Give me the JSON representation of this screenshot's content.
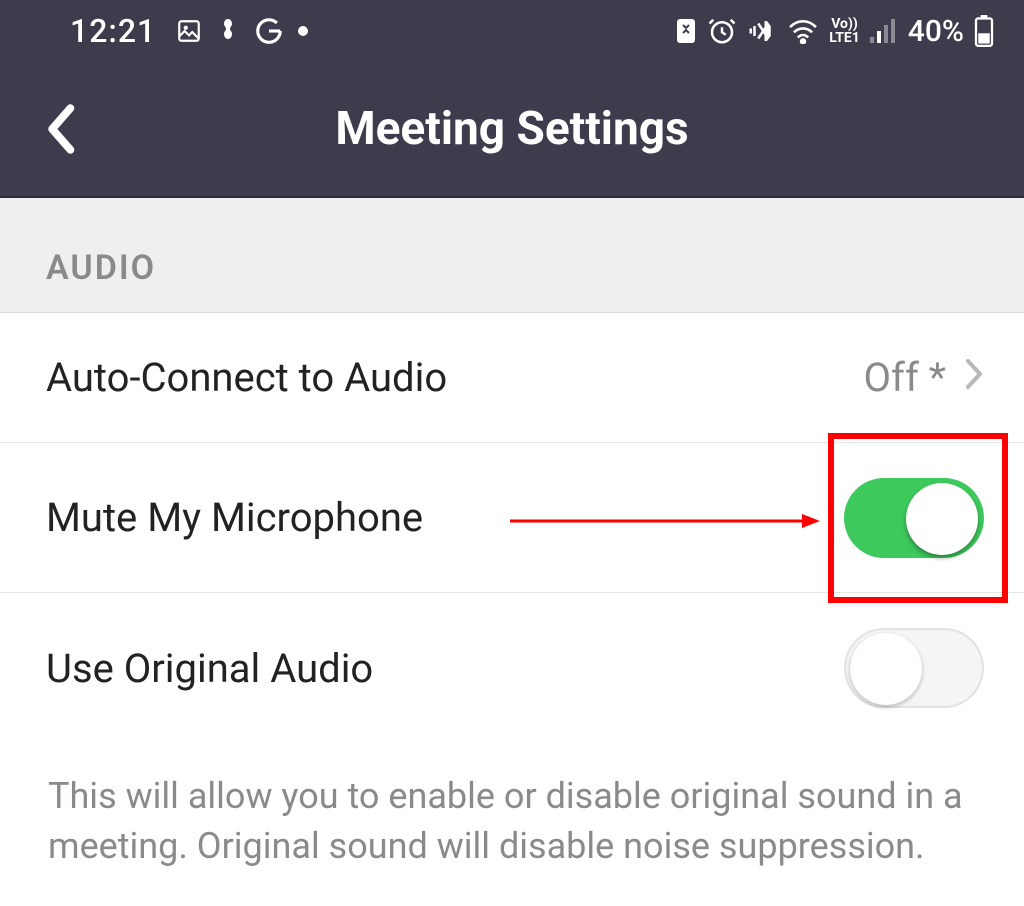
{
  "status": {
    "time": "12:21",
    "battery": "40%"
  },
  "title": "Meeting Settings",
  "section": "AUDIO",
  "rows": {
    "autoConnect": {
      "label": "Auto-Connect to Audio",
      "value": "Off *"
    },
    "muteMic": {
      "label": "Mute My Microphone",
      "on": true
    },
    "origAudio": {
      "label": "Use Original Audio",
      "on": false
    }
  },
  "description": "This will allow you to enable or disable original sound in a meeting. Original sound will disable noise suppression."
}
